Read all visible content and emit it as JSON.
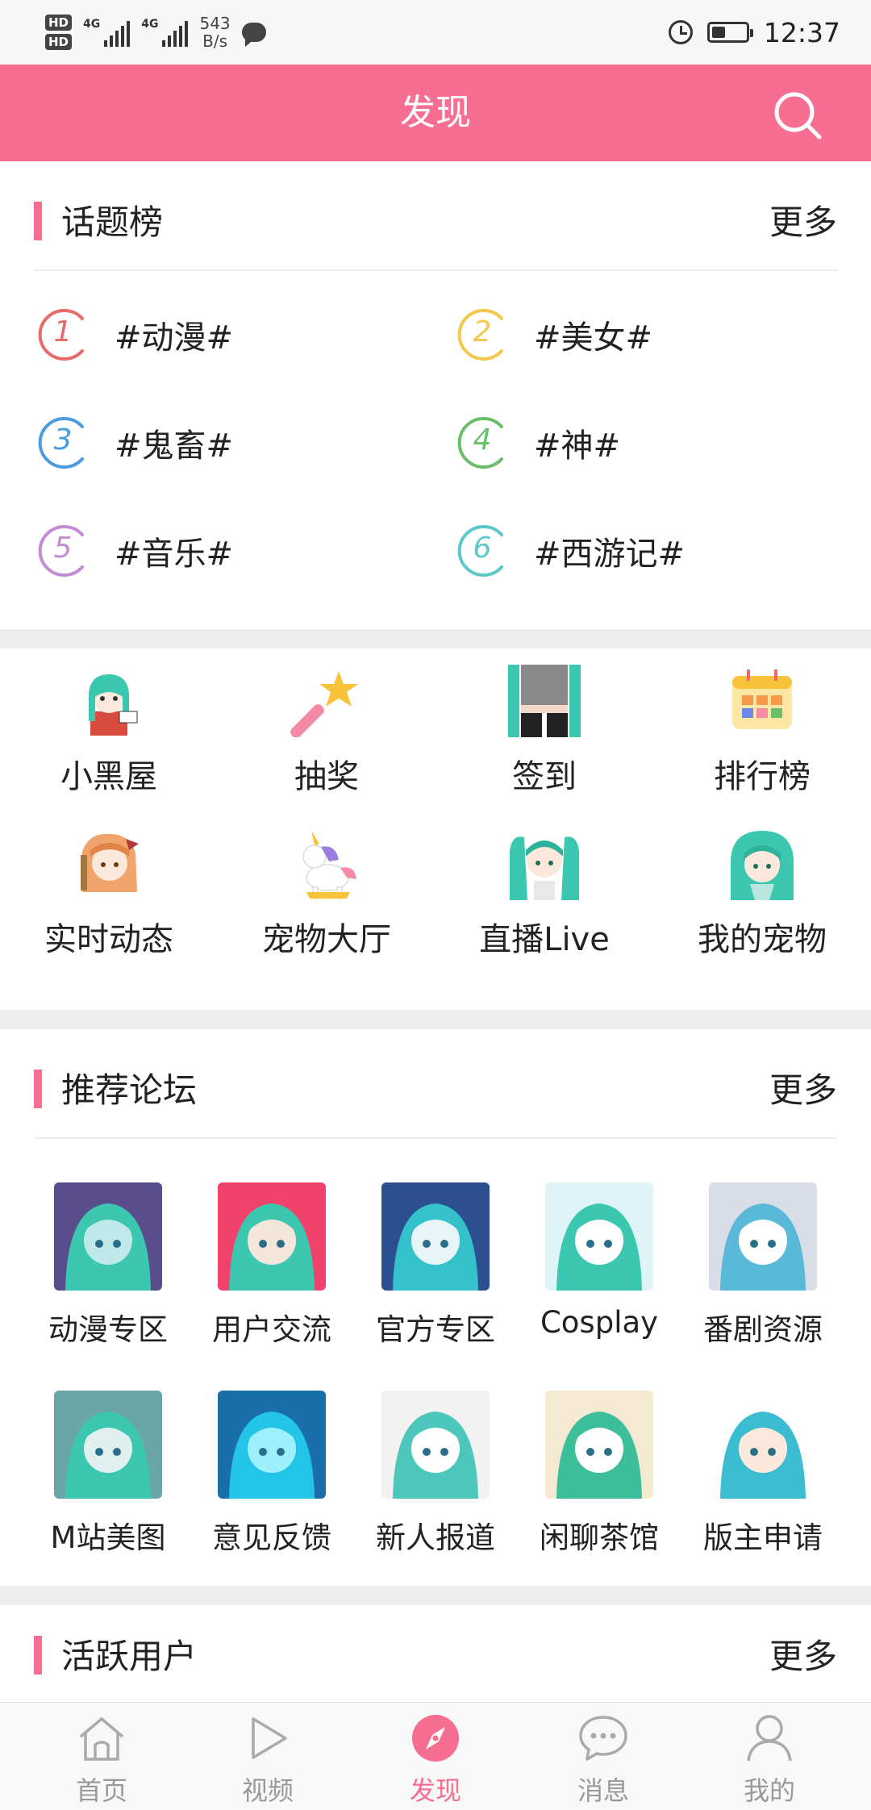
{
  "status_bar": {
    "hd1": "HD",
    "hd2": "HD",
    "sim1": "4G",
    "sim2": "4G",
    "speed_value": "543",
    "speed_unit": "B/s",
    "time": "12:37",
    "battery_level": 0.4
  },
  "header": {
    "title": "发现",
    "search_icon": "search-icon"
  },
  "topics": {
    "title": "话题榜",
    "more": "更多",
    "items": [
      {
        "rank": "1",
        "label": "#动漫#",
        "color": "#e86a6a"
      },
      {
        "rank": "2",
        "label": "#美女#",
        "color": "#f2c94c"
      },
      {
        "rank": "3",
        "label": "#鬼畜#",
        "color": "#4a9be0"
      },
      {
        "rank": "4",
        "label": "#神#",
        "color": "#6cbf6a"
      },
      {
        "rank": "5",
        "label": "#音乐#",
        "color": "#c58bd6"
      },
      {
        "rank": "6",
        "label": "#西游记#",
        "color": "#5cc8c8"
      }
    ]
  },
  "quick_links": [
    {
      "label": "小黑屋",
      "icon": "anime-character-icon"
    },
    {
      "label": "抽奖",
      "icon": "magic-wand-icon"
    },
    {
      "label": "签到",
      "icon": "checkin-character-icon"
    },
    {
      "label": "排行榜",
      "icon": "calendar-icon"
    },
    {
      "label": "实时动态",
      "icon": "anime-girl-icon"
    },
    {
      "label": "宠物大厅",
      "icon": "unicorn-icon"
    },
    {
      "label": "直播Live",
      "icon": "live-character-icon"
    },
    {
      "label": "我的宠物",
      "icon": "pet-character-icon"
    }
  ],
  "forums": {
    "title": "推荐论坛",
    "more": "更多",
    "items": [
      {
        "label": "动漫专区"
      },
      {
        "label": "用户交流"
      },
      {
        "label": "官方专区"
      },
      {
        "label": "Cosplay"
      },
      {
        "label": "番剧资源"
      },
      {
        "label": "M站美图"
      },
      {
        "label": "意见反馈"
      },
      {
        "label": "新人报道"
      },
      {
        "label": "闲聊茶馆"
      },
      {
        "label": "版主申请"
      }
    ]
  },
  "active_users": {
    "title": "活跃用户",
    "more": "更多"
  },
  "tabbar": {
    "active_color": "#f76e93",
    "items": [
      {
        "label": "首页",
        "icon": "home-icon"
      },
      {
        "label": "视频",
        "icon": "play-icon"
      },
      {
        "label": "发现",
        "icon": "compass-icon"
      },
      {
        "label": "消息",
        "icon": "chat-icon"
      },
      {
        "label": "我的",
        "icon": "user-icon"
      }
    ]
  }
}
